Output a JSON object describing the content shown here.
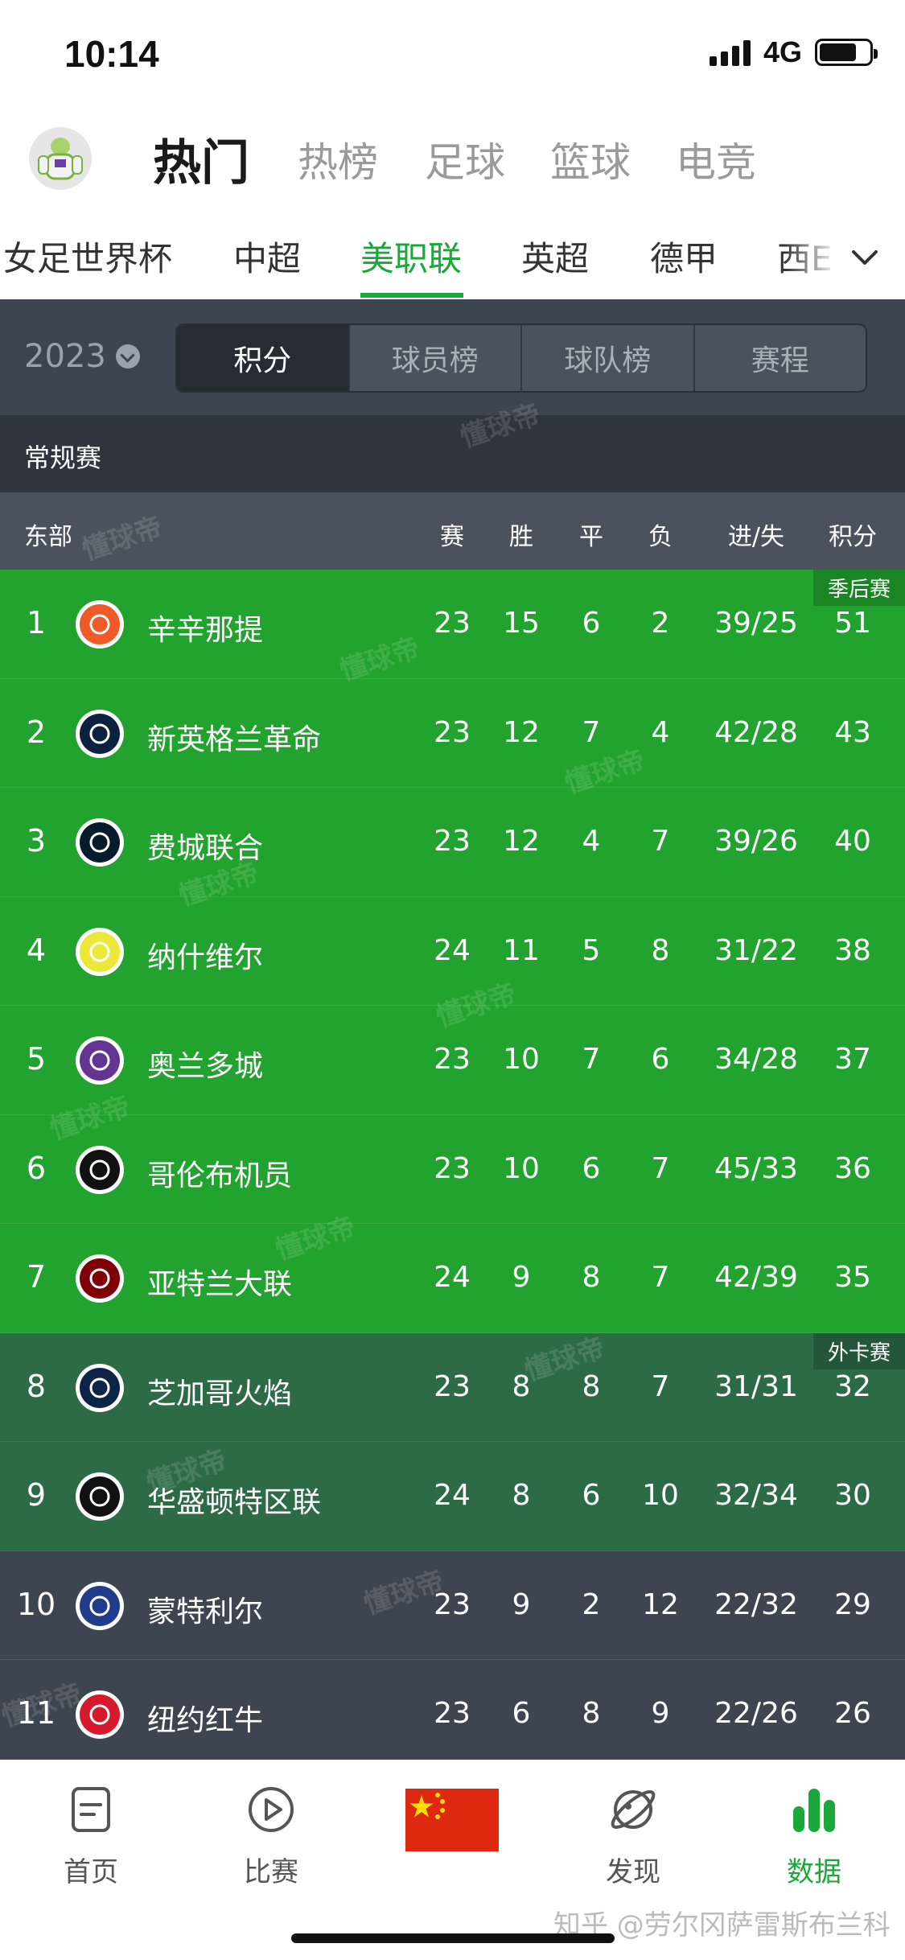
{
  "status_bar": {
    "time": "10:14",
    "network": "4G"
  },
  "top_nav": {
    "tabs": [
      "热门",
      "热榜",
      "足球",
      "篮球",
      "电竞"
    ],
    "active": "热门"
  },
  "league_tabs": {
    "items": [
      "女足世界杯",
      "中超",
      "美职联",
      "英超",
      "德甲",
      "西甲"
    ],
    "active": "美职联",
    "visible_last": "西E"
  },
  "filter": {
    "year": "2023",
    "segments": [
      "积分",
      "球员榜",
      "球队榜",
      "赛程"
    ],
    "active": "积分"
  },
  "section_title": "常规赛",
  "table": {
    "group_label": "东部",
    "columns": [
      "赛",
      "胜",
      "平",
      "负",
      "进/失",
      "积分"
    ],
    "zones": {
      "playoff": "季后赛",
      "wildcard": "外卡赛"
    },
    "colors": {
      "playoff": "#22a22e",
      "wildcard": "#2d6b47",
      "default": "#3d4650"
    },
    "rows": [
      {
        "rank": "1",
        "team": "辛辛那提",
        "mp": "23",
        "w": "15",
        "d": "6",
        "l": "2",
        "gf_ga": "39/25",
        "pts": "51",
        "zone": "playoff",
        "logo_color": "#f05a28"
      },
      {
        "rank": "2",
        "team": "新英格兰革命",
        "mp": "23",
        "w": "12",
        "d": "7",
        "l": "4",
        "gf_ga": "42/28",
        "pts": "43",
        "zone": "playoff",
        "logo_color": "#0a2240"
      },
      {
        "rank": "3",
        "team": "费城联合",
        "mp": "23",
        "w": "12",
        "d": "4",
        "l": "7",
        "gf_ga": "39/26",
        "pts": "40",
        "zone": "playoff",
        "logo_color": "#071b2c"
      },
      {
        "rank": "4",
        "team": "纳什维尔",
        "mp": "24",
        "w": "11",
        "d": "5",
        "l": "8",
        "gf_ga": "31/22",
        "pts": "38",
        "zone": "playoff",
        "logo_color": "#ece83a"
      },
      {
        "rank": "5",
        "team": "奥兰多城",
        "mp": "23",
        "w": "10",
        "d": "7",
        "l": "6",
        "gf_ga": "34/28",
        "pts": "37",
        "zone": "playoff",
        "logo_color": "#633492"
      },
      {
        "rank": "6",
        "team": "哥伦布机员",
        "mp": "23",
        "w": "10",
        "d": "6",
        "l": "7",
        "gf_ga": "45/33",
        "pts": "36",
        "zone": "playoff",
        "logo_color": "#111111"
      },
      {
        "rank": "7",
        "team": "亚特兰大联",
        "mp": "24",
        "w": "9",
        "d": "8",
        "l": "7",
        "gf_ga": "42/39",
        "pts": "35",
        "zone": "playoff",
        "logo_color": "#80000a"
      },
      {
        "rank": "8",
        "team": "芝加哥火焰",
        "mp": "23",
        "w": "8",
        "d": "8",
        "l": "7",
        "gf_ga": "31/31",
        "pts": "32",
        "zone": "wildcard",
        "logo_color": "#0b2447"
      },
      {
        "rank": "9",
        "team": "华盛顿特区联",
        "mp": "24",
        "w": "8",
        "d": "6",
        "l": "10",
        "gf_ga": "32/34",
        "pts": "30",
        "zone": "wildcard",
        "logo_color": "#111111"
      },
      {
        "rank": "10",
        "team": "蒙特利尔",
        "mp": "23",
        "w": "9",
        "d": "2",
        "l": "12",
        "gf_ga": "22/32",
        "pts": "29",
        "zone": "default",
        "logo_color": "#1f3d8c"
      },
      {
        "rank": "11",
        "team": "纽约红牛",
        "mp": "23",
        "w": "6",
        "d": "8",
        "l": "9",
        "gf_ga": "22/26",
        "pts": "26",
        "zone": "default",
        "logo_color": "#d6192c"
      }
    ]
  },
  "watermark": "懂球帝",
  "bottom_nav": {
    "items": [
      {
        "label": "首页",
        "icon": "document-icon"
      },
      {
        "label": "比赛",
        "icon": "play-icon"
      },
      {
        "label": "",
        "icon": "china-flag-icon"
      },
      {
        "label": "发现",
        "icon": "planet-icon"
      },
      {
        "label": "数据",
        "icon": "bar-chart-icon"
      }
    ],
    "active": "数据"
  },
  "footer_watermark": "知乎 @劳尔冈萨雷斯布兰科",
  "accent_color": "#1aa83a"
}
